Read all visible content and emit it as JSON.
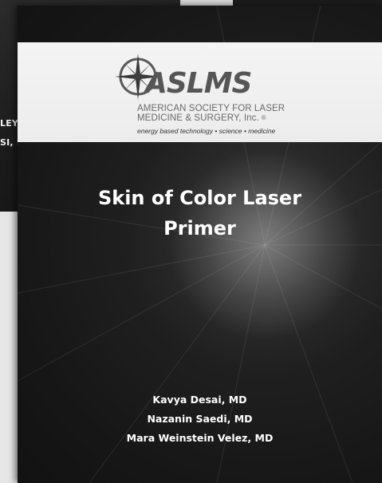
{
  "background_book": {
    "line1": "LEY, ",
    "line2": "SI, M"
  },
  "cover": {
    "logo": {
      "wordmark": "ASLMS",
      "org_line1": "AMERICAN SOCIETY FOR LASER",
      "org_line2": "MEDICINE & SURGERY, Inc.",
      "registered_mark": "®",
      "tagline": "energy based technology • science • medicine",
      "icon": "compass-star-icon"
    },
    "title_line1": "Skin of Color Laser",
    "title_line2": "Primer",
    "authors": [
      "Kavya Desai, MD",
      "Nazanin Saedi, MD",
      "Mara Weinstein Velez, MD"
    ]
  },
  "colors": {
    "cover_background": "#161616",
    "logo_band": "#f0f0f0",
    "logo_gray": "#565656",
    "text": "#ffffff"
  }
}
